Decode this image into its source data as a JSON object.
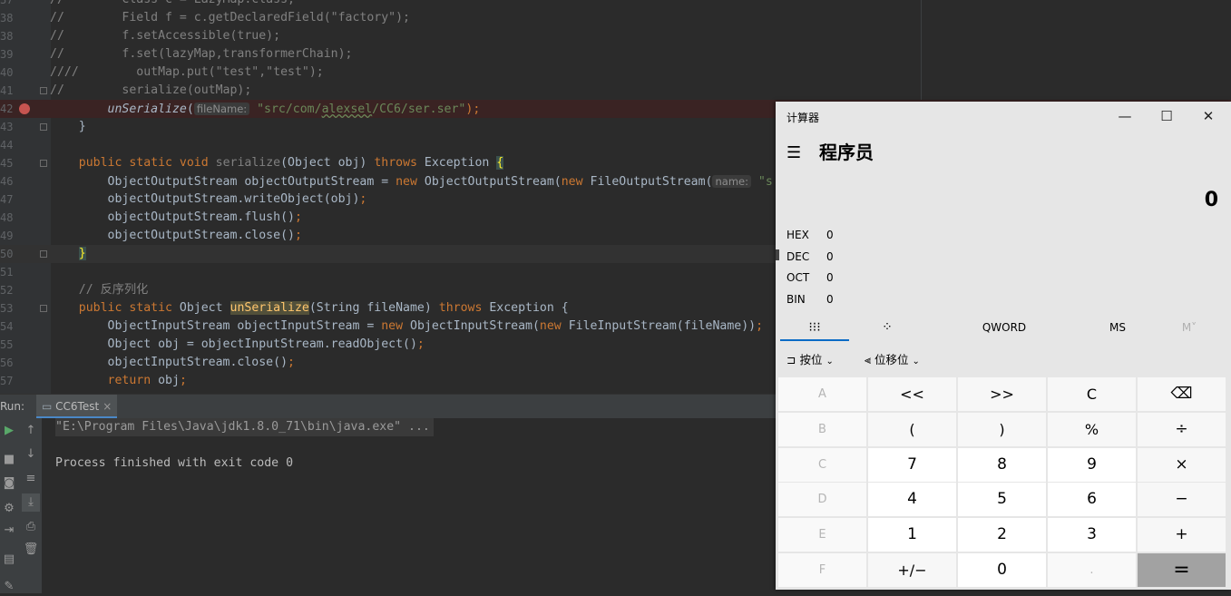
{
  "editor": {
    "lines": [
      {
        "no": "37",
        "segments": [
          {
            "t": "//        Class c = LazyMap.class;",
            "c": "c-com"
          }
        ]
      },
      {
        "no": "38",
        "segments": [
          {
            "t": "//        Field f = c.getDeclaredField(\"factory\");",
            "c": "c-com"
          }
        ]
      },
      {
        "no": "38",
        "segments": [
          {
            "t": "//        f.setAccessible(true);",
            "c": "c-com"
          }
        ]
      },
      {
        "no": "39",
        "segments": [
          {
            "t": "//        f.set(lazyMap,transformerChain);",
            "c": "c-com"
          }
        ]
      },
      {
        "no": "40",
        "segments": [
          {
            "t": "////        outMap.put(\"test\",\"test\");",
            "c": "c-com"
          }
        ]
      },
      {
        "no": "41",
        "segments": [
          {
            "t": "//        serialize(outMap);",
            "c": "c-com"
          }
        ]
      },
      {
        "no": "42",
        "segments": [
          {
            "t": "        ",
            "c": ""
          },
          {
            "t": "unSerialize",
            "c": "c-it"
          },
          {
            "t": "(",
            "c": ""
          },
          {
            "t": "fileName:",
            "c": "hint"
          },
          {
            "t": " ",
            "c": ""
          },
          {
            "t": "\"src/com/",
            "c": "c-str"
          },
          {
            "t": "alexsel",
            "c": "c-str squig"
          },
          {
            "t": "/CC6/ser.ser\"",
            "c": "c-str"
          },
          {
            "t": ");",
            "c": "c-kw"
          }
        ]
      },
      {
        "no": "43",
        "segments": [
          {
            "t": "    }",
            "c": ""
          }
        ]
      },
      {
        "no": "44",
        "segments": [
          {
            "t": "",
            "c": ""
          }
        ]
      },
      {
        "no": "45",
        "segments": [
          {
            "t": "    ",
            "c": ""
          },
          {
            "t": "public static void ",
            "c": "c-kw"
          },
          {
            "t": "serialize",
            "c": "c-dim"
          },
          {
            "t": "(Object obj) ",
            "c": ""
          },
          {
            "t": "throws ",
            "c": "c-kw"
          },
          {
            "t": "Exception ",
            "c": ""
          },
          {
            "t": "{",
            "c": "brace-hl"
          }
        ]
      },
      {
        "no": "46",
        "segments": [
          {
            "t": "        ObjectOutputStream objectOutputStream = ",
            "c": ""
          },
          {
            "t": "new ",
            "c": "c-kw"
          },
          {
            "t": "ObjectOutputStream(",
            "c": ""
          },
          {
            "t": "new ",
            "c": "c-kw"
          },
          {
            "t": "FileOutputStream(",
            "c": ""
          },
          {
            "t": "name:",
            "c": "hint"
          },
          {
            "t": " \"s",
            "c": "c-str"
          }
        ]
      },
      {
        "no": "47",
        "segments": [
          {
            "t": "        objectOutputStream.writeObject(obj)",
            "c": ""
          },
          {
            "t": ";",
            "c": "c-kw"
          }
        ]
      },
      {
        "no": "48",
        "segments": [
          {
            "t": "        objectOutputStream.flush()",
            "c": ""
          },
          {
            "t": ";",
            "c": "c-kw"
          }
        ]
      },
      {
        "no": "49",
        "segments": [
          {
            "t": "        objectOutputStream.close()",
            "c": ""
          },
          {
            "t": ";",
            "c": "c-kw"
          }
        ]
      },
      {
        "no": "50",
        "segments": [
          {
            "t": "    ",
            "c": ""
          },
          {
            "t": "}",
            "c": "brace-hl"
          }
        ]
      },
      {
        "no": "51",
        "segments": [
          {
            "t": "",
            "c": ""
          }
        ]
      },
      {
        "no": "52",
        "segments": [
          {
            "t": "    // 反序列化",
            "c": "c-com"
          }
        ]
      },
      {
        "no": "53",
        "segments": [
          {
            "t": "    ",
            "c": ""
          },
          {
            "t": "public static ",
            "c": "c-kw"
          },
          {
            "t": "Object ",
            "c": ""
          },
          {
            "t": "unSerialize",
            "c": "hl-unser"
          },
          {
            "t": "(String fileName) ",
            "c": ""
          },
          {
            "t": "throws ",
            "c": "c-kw"
          },
          {
            "t": "Exception {",
            "c": ""
          }
        ]
      },
      {
        "no": "54",
        "segments": [
          {
            "t": "        ObjectInputStream objectInputStream = ",
            "c": ""
          },
          {
            "t": "new ",
            "c": "c-kw"
          },
          {
            "t": "ObjectInputStream(",
            "c": ""
          },
          {
            "t": "new ",
            "c": "c-kw"
          },
          {
            "t": "FileInputStream(fileName))",
            "c": ""
          },
          {
            "t": ";",
            "c": "c-kw"
          }
        ]
      },
      {
        "no": "55",
        "segments": [
          {
            "t": "        Object obj = objectInputStream.readObject()",
            "c": ""
          },
          {
            "t": ";",
            "c": "c-kw"
          }
        ]
      },
      {
        "no": "56",
        "segments": [
          {
            "t": "        objectInputStream.close()",
            "c": ""
          },
          {
            "t": ";",
            "c": "c-kw"
          }
        ]
      },
      {
        "no": "57",
        "segments": [
          {
            "t": "        ",
            "c": ""
          },
          {
            "t": "return ",
            "c": "c-kw"
          },
          {
            "t": "obj",
            "c": ""
          },
          {
            "t": ";",
            "c": "c-kw"
          }
        ]
      }
    ]
  },
  "run": {
    "label": "Run:",
    "tab_label": "CC6Test",
    "tab_close": "×",
    "command": "\"E:\\Program Files\\Java\\jdk1.8.0_71\\bin\\java.exe\" ...",
    "result": "Process finished with exit code 0"
  },
  "calculator": {
    "title": "计算器",
    "mode": "程序员",
    "display": "0",
    "bases": [
      {
        "name": "HEX",
        "value": "0"
      },
      {
        "name": "DEC",
        "value": "0"
      },
      {
        "name": "OCT",
        "value": "0"
      },
      {
        "name": "BIN",
        "value": "0"
      }
    ],
    "word_size": "QWORD",
    "mem_store": "MS",
    "mem_recall": "M˅",
    "bitwise_label": "按位",
    "bitshift_label": "位移位",
    "keys": [
      [
        "A",
        "<<",
        ">>",
        "C",
        "⌫"
      ],
      [
        "B",
        "(",
        ")",
        "%",
        "÷"
      ],
      [
        "C",
        "7",
        "8",
        "9",
        "×"
      ],
      [
        "D",
        "4",
        "5",
        "6",
        "−"
      ],
      [
        "E",
        "1",
        "2",
        "3",
        "+"
      ],
      [
        "F",
        "+/−",
        "0",
        ".",
        "="
      ]
    ]
  }
}
